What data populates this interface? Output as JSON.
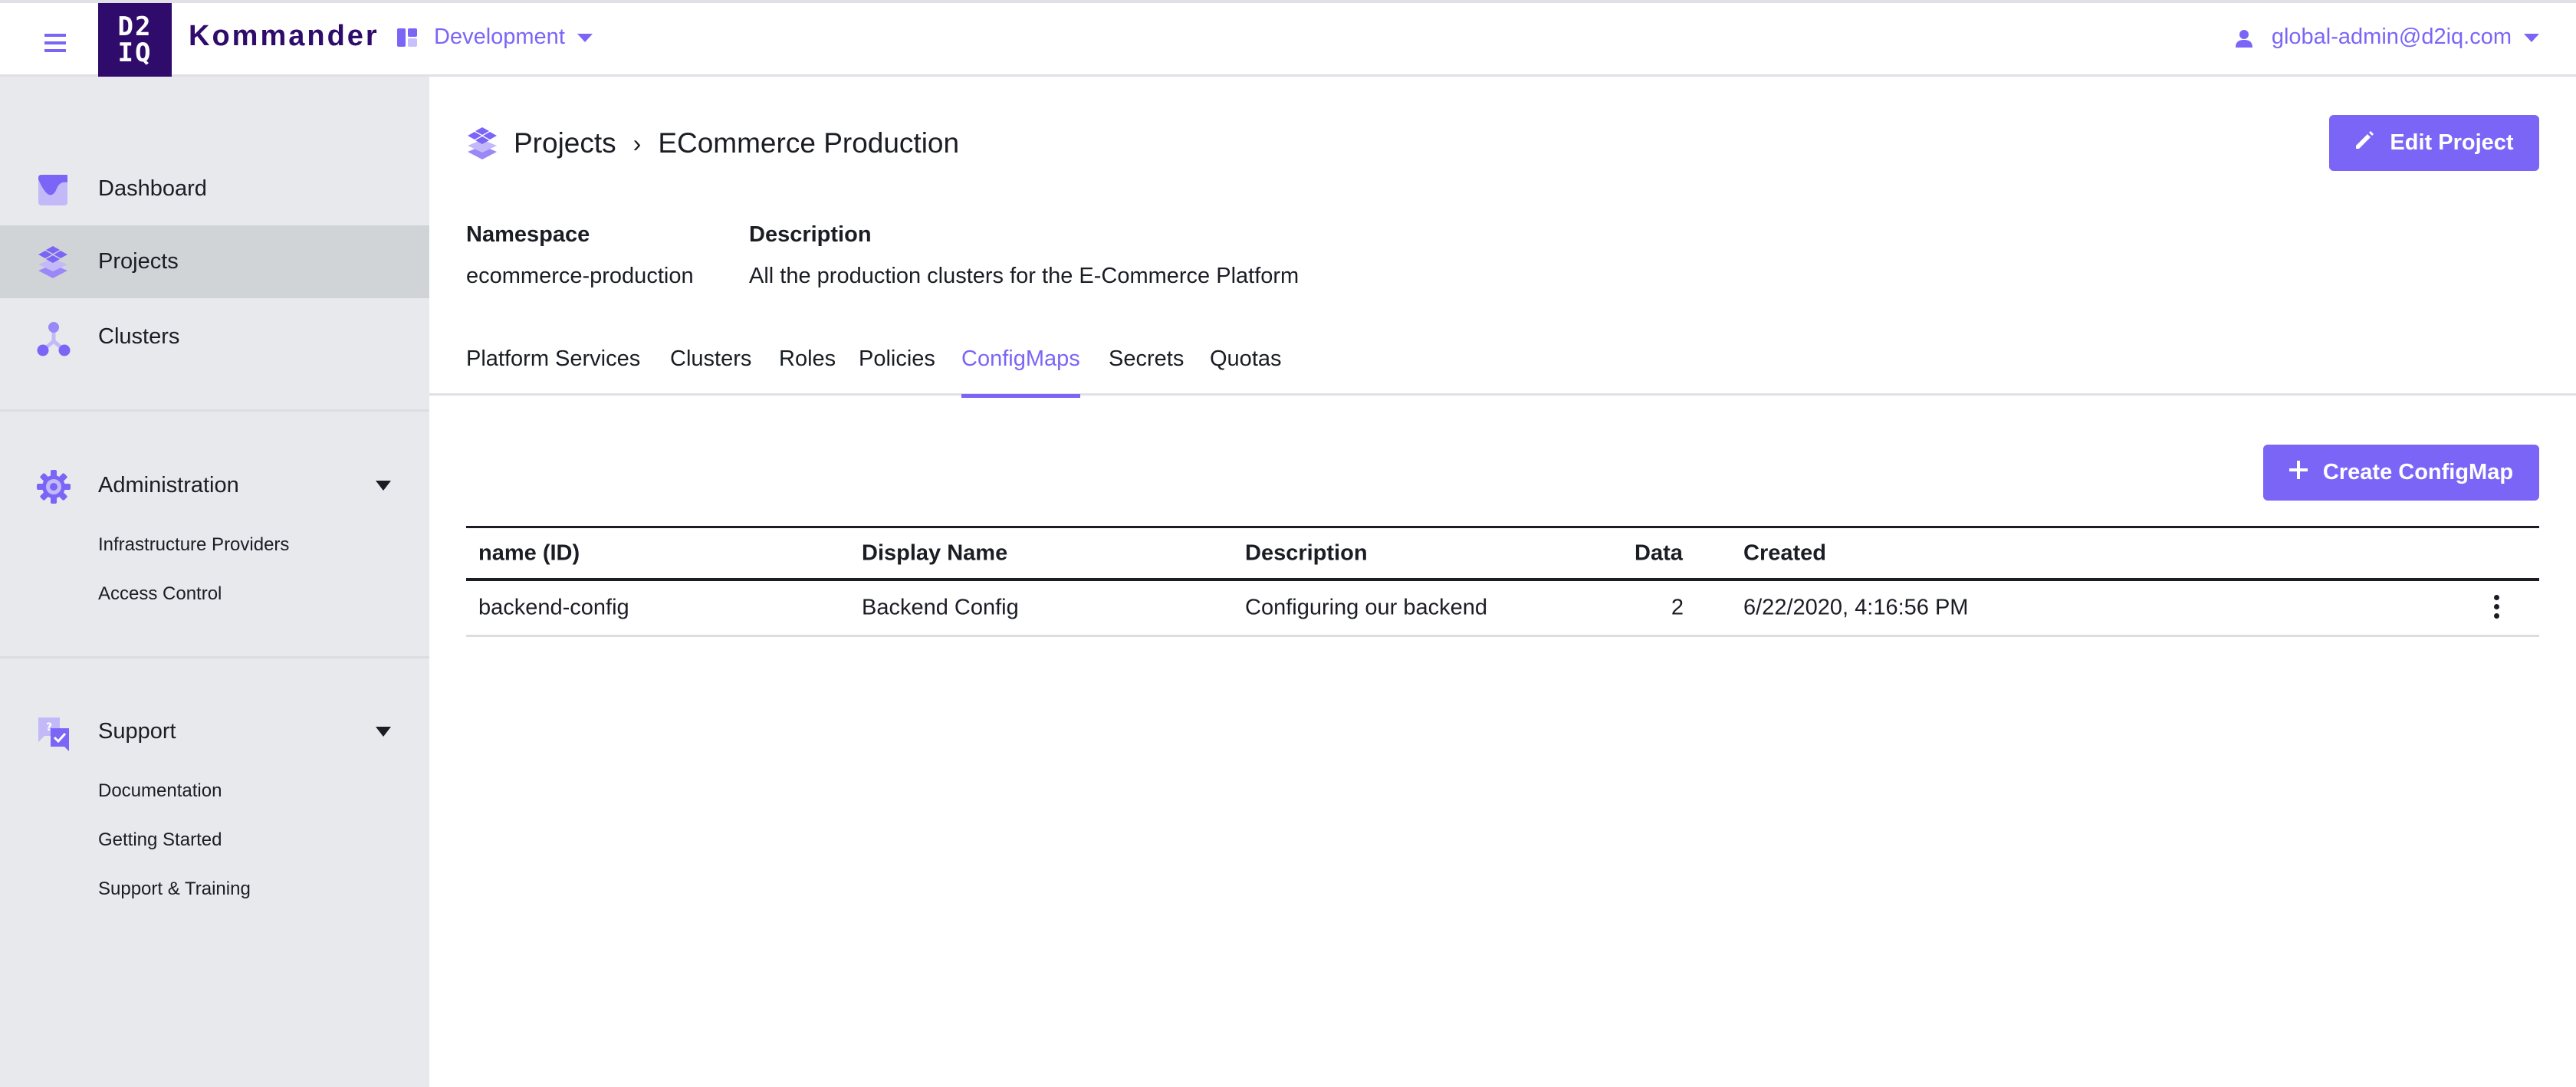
{
  "header": {
    "logo_line1": "D2",
    "logo_line2": "IQ",
    "brand": "Kommander",
    "workspace": "Development",
    "user": "global-admin@d2iq.com"
  },
  "sidebar": {
    "items": [
      {
        "label": "Dashboard",
        "icon": "dashboard-icon"
      },
      {
        "label": "Projects",
        "icon": "projects-icon",
        "active": true
      },
      {
        "label": "Clusters",
        "icon": "clusters-icon"
      }
    ],
    "administration": {
      "label": "Administration",
      "icon": "gear-icon",
      "items": [
        "Infrastructure Providers",
        "Access Control"
      ]
    },
    "support": {
      "label": "Support",
      "icon": "support-icon",
      "items": [
        "Documentation",
        "Getting Started",
        "Support & Training"
      ]
    }
  },
  "main": {
    "breadcrumb": {
      "root": "Projects",
      "separator": "›",
      "current": "ECommerce Production"
    },
    "edit_button": "Edit Project",
    "meta": {
      "namespace_label": "Namespace",
      "namespace_value": "ecommerce-production",
      "description_label": "Description",
      "description_value": "All the production clusters for the E-Commerce Platform"
    },
    "tabs": [
      {
        "label": "Platform Services"
      },
      {
        "label": "Clusters"
      },
      {
        "label": "Roles"
      },
      {
        "label": "Policies"
      },
      {
        "label": "ConfigMaps",
        "active": true
      },
      {
        "label": "Secrets"
      },
      {
        "label": "Quotas"
      }
    ],
    "create_button": "Create ConfigMap",
    "table": {
      "columns": [
        "name (ID)",
        "Display Name",
        "Description",
        "Data",
        "Created"
      ],
      "rows": [
        {
          "name": "backend-config",
          "display_name": "Backend Config",
          "description": "Configuring our backend",
          "data": "2",
          "created": "6/22/2020, 4:16:56 PM"
        }
      ]
    }
  },
  "colors": {
    "accent": "#7b65f7",
    "brand_dark": "#2f0c6b",
    "sidebar_bg": "#e8e9ed",
    "sidebar_active": "#d1d4d7",
    "text": "#1b1d24"
  }
}
